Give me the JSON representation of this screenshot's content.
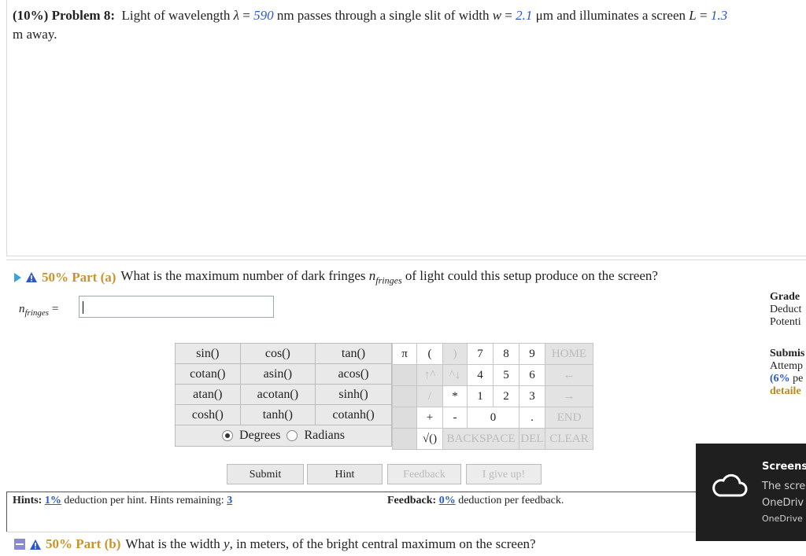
{
  "problem": {
    "prefix": "(10%) Problem 8:",
    "text1": "Light of wavelength ",
    "lambda_sym": "λ",
    "eq": " = ",
    "lambda_val": "590",
    "text2": " nm passes through a single slit of width ",
    "w_sym": "w",
    "w_val": "2.1",
    "text3": " μm and illuminates a screen ",
    "L_sym": "L",
    "L_val": "1.3",
    "line2": "m away."
  },
  "part_a": {
    "percent": "50% Part (a)",
    "question_pre": "What is the maximum number of dark fringes ",
    "var": "n",
    "var_sub": "fringes",
    "question_post": " of light could this setup produce on the screen?",
    "answer_label": "n",
    "answer_sub": "fringes",
    "answer_eq": " =",
    "answer_value": ""
  },
  "sidebar": {
    "grade_h": "Grade",
    "deduct": "Deduct",
    "potential": "Potenti",
    "submis_h": "Submis",
    "attempt": "Attemp",
    "pct": "(6%",
    "pe": "pe",
    "detailed": "detaile"
  },
  "calculator": {
    "functions": [
      [
        "sin()",
        "cos()",
        "tan()"
      ],
      [
        "cotan()",
        "asin()",
        "acos()"
      ],
      [
        "atan()",
        "acotan()",
        "sinh()"
      ],
      [
        "cosh()",
        "tanh()",
        "cotanh()"
      ]
    ],
    "degrees": "Degrees",
    "radians": "Radians",
    "pi": "π",
    "open_paren": "(",
    "close_paren": ")",
    "up_caret": "↑^",
    "down_caret": "^↓",
    "slash": "/",
    "star": "*",
    "plus": "+",
    "minus": "-",
    "sqrt": "√()",
    "digits": [
      "7",
      "8",
      "9",
      "4",
      "5",
      "6",
      "1",
      "2",
      "3",
      "0"
    ],
    "dot": ".",
    "home": "HOME",
    "left": "←",
    "right": "→",
    "end": "END",
    "backspace": "BACKSPACE",
    "del": "DEL",
    "clear": "CLEAR"
  },
  "buttons": {
    "submit": "Submit",
    "hint": "Hint",
    "feedback": "Feedback",
    "give_up": "I give up!"
  },
  "hints": {
    "label": "Hints:",
    "pct": "1%",
    "text": " deduction per hint. Hints remaining: ",
    "remaining": "3"
  },
  "feedback": {
    "label": "Feedback:",
    "pct": "0%",
    "text": " deduction per feedback."
  },
  "part_b": {
    "percent": "50% Part (b)",
    "question_pre": "What is the width ",
    "var": "y",
    "question_post": ", in meters, of the bright central maximum on the screen?"
  },
  "toast": {
    "title": "Screensl",
    "line1": "The scre",
    "line2": "OneDriv",
    "source": "OneDrive"
  },
  "colors": {
    "accent_blue": "#2a57c9",
    "part_gold": "#c8942a",
    "toast_bg": "#1f1f1f"
  }
}
